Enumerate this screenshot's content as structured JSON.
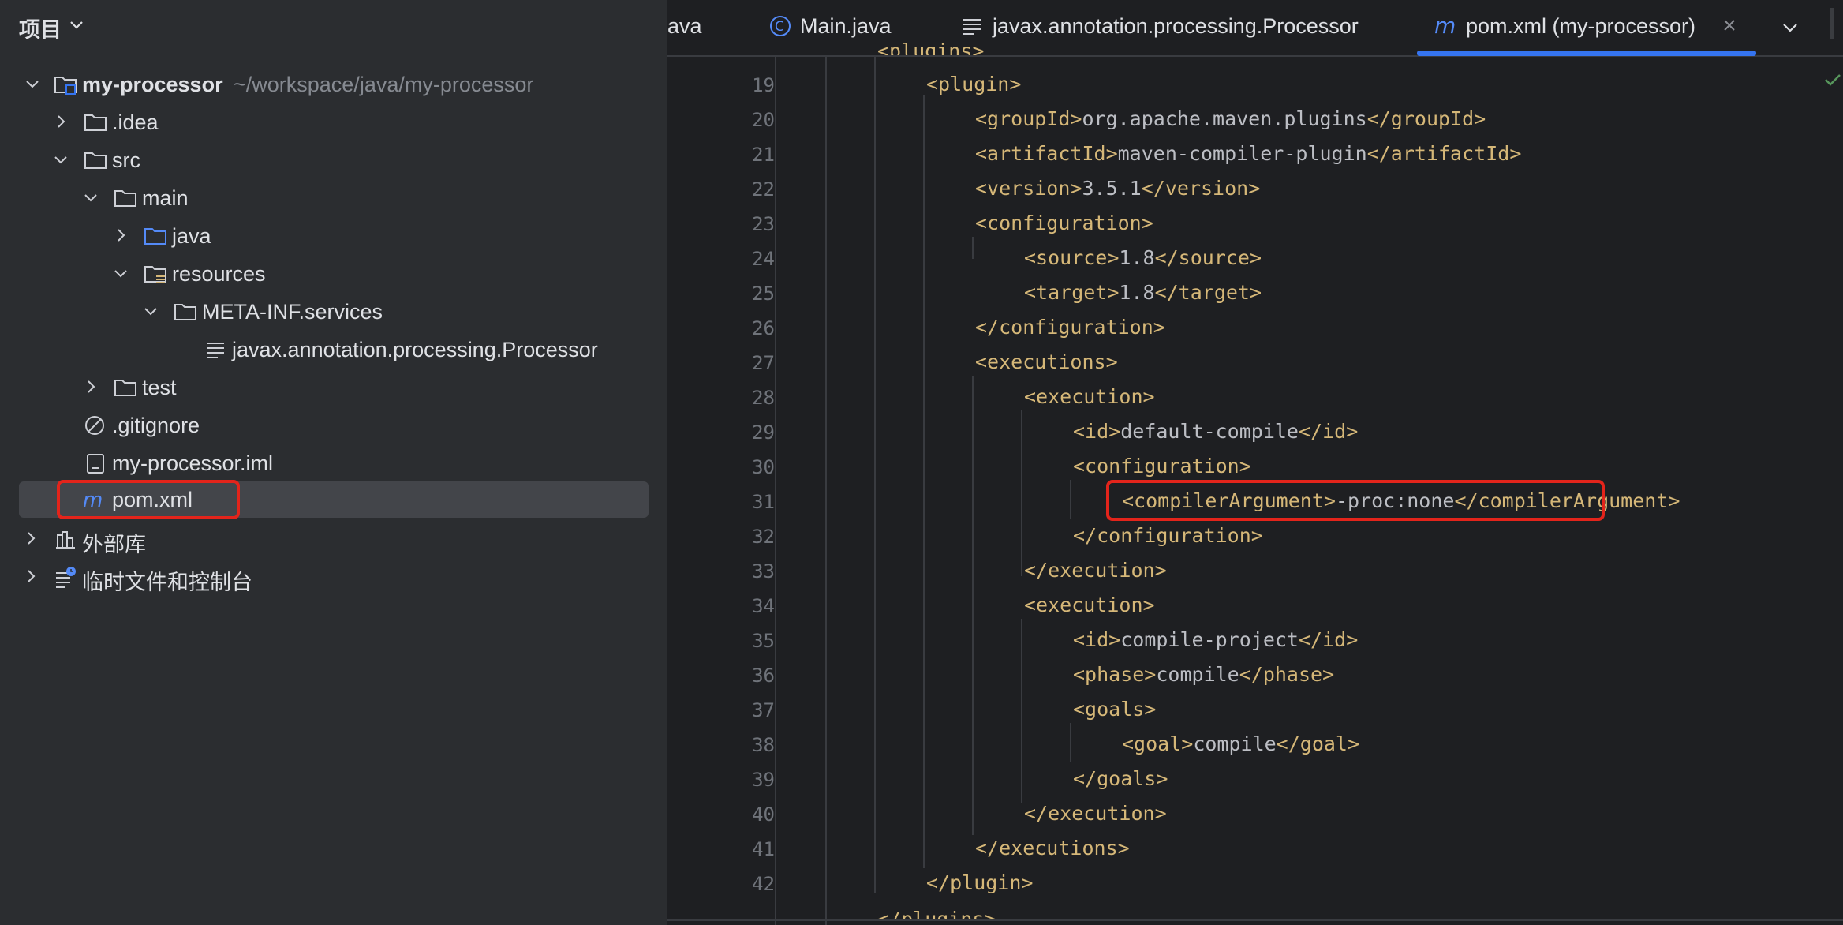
{
  "project_panel": {
    "title": "项目",
    "tree": [
      {
        "label": "my-processor",
        "path": "~/workspace/java/my-processor"
      },
      {
        "label": ".idea"
      },
      {
        "label": "src"
      },
      {
        "label": "main"
      },
      {
        "label": "java"
      },
      {
        "label": "resources"
      },
      {
        "label": "META-INF.services"
      },
      {
        "label": "javax.annotation.processing.Processor"
      },
      {
        "label": "test"
      },
      {
        "label": ".gitignore"
      },
      {
        "label": "my-processor.iml"
      },
      {
        "label": "pom.xml"
      },
      {
        "label": "外部库"
      },
      {
        "label": "临时文件和控制台"
      }
    ]
  },
  "tabs": [
    {
      "label": "ava"
    },
    {
      "label": "Main.java"
    },
    {
      "label": "javax.annotation.processing.Processor"
    },
    {
      "label": "pom.xml (my-processor)"
    }
  ],
  "editor": {
    "lines": [
      {
        "n": "19",
        "open": "<plugin>",
        "text": "",
        "close": ""
      },
      {
        "n": "20",
        "open": "<groupId>",
        "text": "org.apache.maven.plugins",
        "close": "</groupId>"
      },
      {
        "n": "21",
        "open": "<artifactId>",
        "text": "maven-compiler-plugin",
        "close": "</artifactId>"
      },
      {
        "n": "22",
        "open": "<version>",
        "text": "3.5.1",
        "close": "</version>"
      },
      {
        "n": "23",
        "open": "<configuration>",
        "text": "",
        "close": ""
      },
      {
        "n": "24",
        "open": "<source>",
        "text": "1.8",
        "close": "</source>"
      },
      {
        "n": "25",
        "open": "<target>",
        "text": "1.8",
        "close": "</target>"
      },
      {
        "n": "26",
        "open": "</configuration>",
        "text": "",
        "close": ""
      },
      {
        "n": "27",
        "open": "<executions>",
        "text": "",
        "close": ""
      },
      {
        "n": "28",
        "open": "<execution>",
        "text": "",
        "close": ""
      },
      {
        "n": "29",
        "open": "<id>",
        "text": "default-compile",
        "close": "</id>"
      },
      {
        "n": "30",
        "open": "<configuration>",
        "text": "",
        "close": ""
      },
      {
        "n": "31",
        "open": "<compilerArgument>",
        "text": "-proc:none",
        "close": "</compilerArgument>"
      },
      {
        "n": "32",
        "open": "</configuration>",
        "text": "",
        "close": ""
      },
      {
        "n": "33",
        "open": "</execution>",
        "text": "",
        "close": ""
      },
      {
        "n": "34",
        "open": "<execution>",
        "text": "",
        "close": ""
      },
      {
        "n": "35",
        "open": "<id>",
        "text": "compile-project",
        "close": "</id>"
      },
      {
        "n": "36",
        "open": "<phase>",
        "text": "compile",
        "close": "</phase>"
      },
      {
        "n": "37",
        "open": "<goals>",
        "text": "",
        "close": ""
      },
      {
        "n": "38",
        "open": "<goal>",
        "text": "compile",
        "close": "</goal>"
      },
      {
        "n": "39",
        "open": "</goals>",
        "text": "",
        "close": ""
      },
      {
        "n": "40",
        "open": "</execution>",
        "text": "",
        "close": ""
      },
      {
        "n": "41",
        "open": "</executions>",
        "text": "",
        "close": ""
      },
      {
        "n": "42",
        "open": "</plugin>",
        "text": "",
        "close": ""
      }
    ]
  },
  "colors": {
    "accent": "#3574f0",
    "highlight": "#e3241b",
    "tag": "#d5b778"
  }
}
